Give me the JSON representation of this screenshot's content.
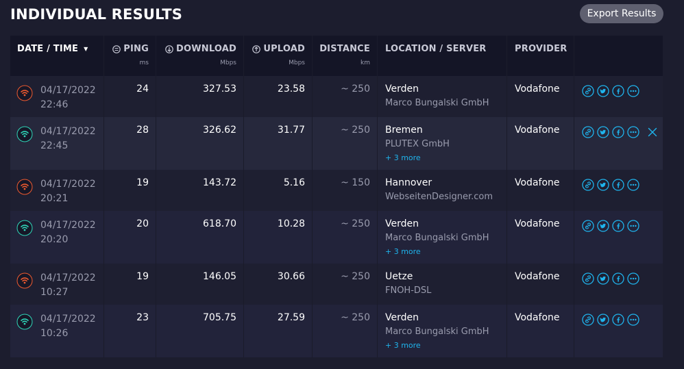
{
  "page": {
    "title": "INDIVIDUAL RESULTS",
    "export_label": "Export Results"
  },
  "colors": {
    "accent": "#1fb4ed",
    "bad": "#ef5a2f",
    "good": "#2fd6b8"
  },
  "columns": {
    "date": "DATE / TIME",
    "ping": "PING",
    "ping_unit": "ms",
    "download": "DOWNLOAD",
    "download_unit": "Mbps",
    "upload": "UPLOAD",
    "upload_unit": "Mbps",
    "distance": "DISTANCE",
    "distance_unit": "km",
    "location": "LOCATION / SERVER",
    "provider": "PROVIDER"
  },
  "rows": [
    {
      "date": "04/17/2022",
      "time": "22:46",
      "quality": "bad",
      "ping": "24",
      "download": "327.53",
      "upload": "23.58",
      "distance": "~ 250",
      "city": "Verden",
      "server": "Marco Bungalski GmbH",
      "more": "",
      "provider": "Vodafone"
    },
    {
      "date": "04/17/2022",
      "time": "22:45",
      "quality": "good",
      "ping": "28",
      "download": "326.62",
      "upload": "31.77",
      "distance": "~ 250",
      "city": "Bremen",
      "server": "PLUTEX GmbH",
      "more": "+ 3 more",
      "provider": "Vodafone"
    },
    {
      "date": "04/17/2022",
      "time": "20:21",
      "quality": "bad",
      "ping": "19",
      "download": "143.72",
      "upload": "5.16",
      "distance": "~ 150",
      "city": "Hannover",
      "server": "WebseitenDesigner.com",
      "more": "",
      "provider": "Vodafone"
    },
    {
      "date": "04/17/2022",
      "time": "20:20",
      "quality": "good",
      "ping": "20",
      "download": "618.70",
      "upload": "10.28",
      "distance": "~ 250",
      "city": "Verden",
      "server": "Marco Bungalski GmbH",
      "more": "+ 3 more",
      "provider": "Vodafone"
    },
    {
      "date": "04/17/2022",
      "time": "10:27",
      "quality": "bad",
      "ping": "19",
      "download": "146.05",
      "upload": "30.66",
      "distance": "~ 250",
      "city": "Uetze",
      "server": "FNOH-DSL",
      "more": "",
      "provider": "Vodafone"
    },
    {
      "date": "04/17/2022",
      "time": "10:26",
      "quality": "good",
      "ping": "23",
      "download": "705.75",
      "upload": "27.59",
      "distance": "~ 250",
      "city": "Verden",
      "server": "Marco Bungalski GmbH",
      "more": "+ 3 more",
      "provider": "Vodafone"
    }
  ]
}
